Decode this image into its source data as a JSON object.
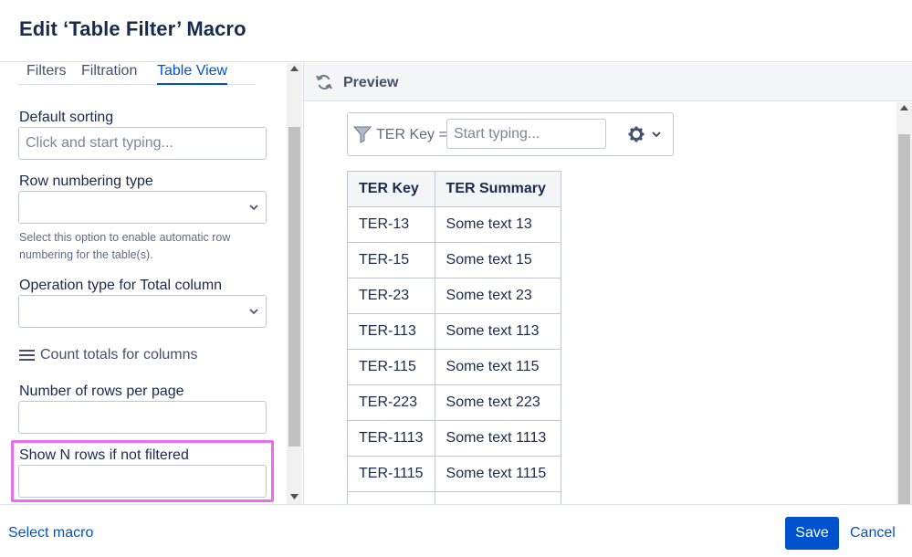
{
  "dialog": {
    "title": "Edit ‘Table Filter’ Macro"
  },
  "tabs": [
    {
      "label": "Filters",
      "active": false
    },
    {
      "label": "Filtration",
      "active": false
    },
    {
      "label": "Table View",
      "active": true
    }
  ],
  "left_panel": {
    "default_sorting": {
      "label": "Default sorting",
      "placeholder": "Click and start typing...",
      "value": ""
    },
    "row_numbering": {
      "label": "Row numbering type",
      "value": "",
      "help": "Select this option to enable automatic row numbering for the table(s)."
    },
    "operation_type": {
      "label": "Operation type for Total column",
      "value": ""
    },
    "count_totals": {
      "label": "Count totals for columns",
      "icon": "list-icon"
    },
    "rows_per_page": {
      "label": "Number of rows per page",
      "value": ""
    },
    "show_n_rows": {
      "label": "Show N rows if not filtered",
      "value": ""
    },
    "highlight_color": "#e86ef0"
  },
  "preview": {
    "title": "Preview",
    "filter": {
      "label": "TER Key =",
      "placeholder": "Start typing...",
      "value": ""
    },
    "table": {
      "headers": [
        "TER Key",
        "TER Summary"
      ],
      "rows": [
        [
          "TER-13",
          "Some text 13"
        ],
        [
          "TER-15",
          "Some text 15"
        ],
        [
          "TER-23",
          "Some text 23"
        ],
        [
          "TER-113",
          "Some text 113"
        ],
        [
          "TER-115",
          "Some text 115"
        ],
        [
          "TER-223",
          "Some text 223"
        ],
        [
          "TER-1113",
          "Some text 1113"
        ],
        [
          "TER-1115",
          "Some text 1115"
        ],
        [
          "",
          ""
        ]
      ]
    }
  },
  "footer": {
    "select_macro": "Select macro",
    "save": "Save",
    "cancel": "Cancel"
  },
  "colors": {
    "accent": "#0052cc",
    "text": "#172b4d",
    "border": "#c1c7d0"
  }
}
